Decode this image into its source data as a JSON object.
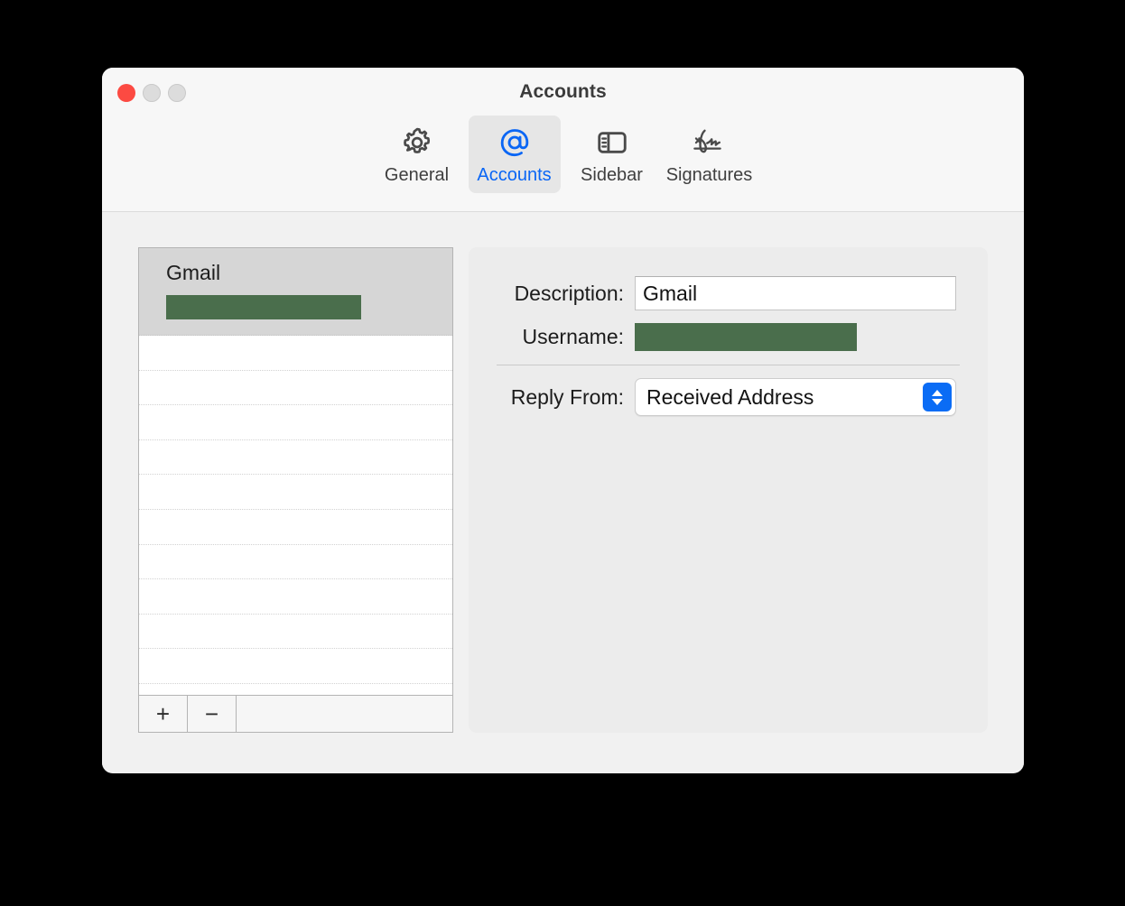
{
  "window": {
    "title": "Accounts",
    "traffic_lights": [
      {
        "name": "close",
        "color": "#fc4a42"
      },
      {
        "name": "minimize",
        "color": "#dcdcdc"
      },
      {
        "name": "zoom",
        "color": "#dcdcdc"
      }
    ]
  },
  "toolbar": {
    "tabs": [
      {
        "id": "general",
        "label": "General",
        "icon": "gear-icon",
        "selected": false
      },
      {
        "id": "accounts",
        "label": "Accounts",
        "icon": "at-sign-icon",
        "selected": true
      },
      {
        "id": "sidebar",
        "label": "Sidebar",
        "icon": "sidebar-icon",
        "selected": false
      },
      {
        "id": "signatures",
        "label": "Signatures",
        "icon": "signature-icon",
        "selected": false
      }
    ],
    "selected_color": "#0a66f5"
  },
  "accounts_list": {
    "rows": [
      {
        "name": "Gmail",
        "email_redacted": true,
        "selected": true
      }
    ],
    "empty_row_count": 12,
    "footer": {
      "add_label": "+",
      "remove_label": "−"
    }
  },
  "detail": {
    "description": {
      "label": "Description:",
      "value": "Gmail"
    },
    "username": {
      "label": "Username:",
      "value": "",
      "redacted": true
    },
    "reply_from": {
      "label": "Reply From:",
      "selected_option": "Received Address"
    }
  },
  "colors": {
    "redaction": "#4a6e4c",
    "accent": "#0a6cf5",
    "panel_bg": "#ececec",
    "window_bg": "#f6f6f6"
  }
}
